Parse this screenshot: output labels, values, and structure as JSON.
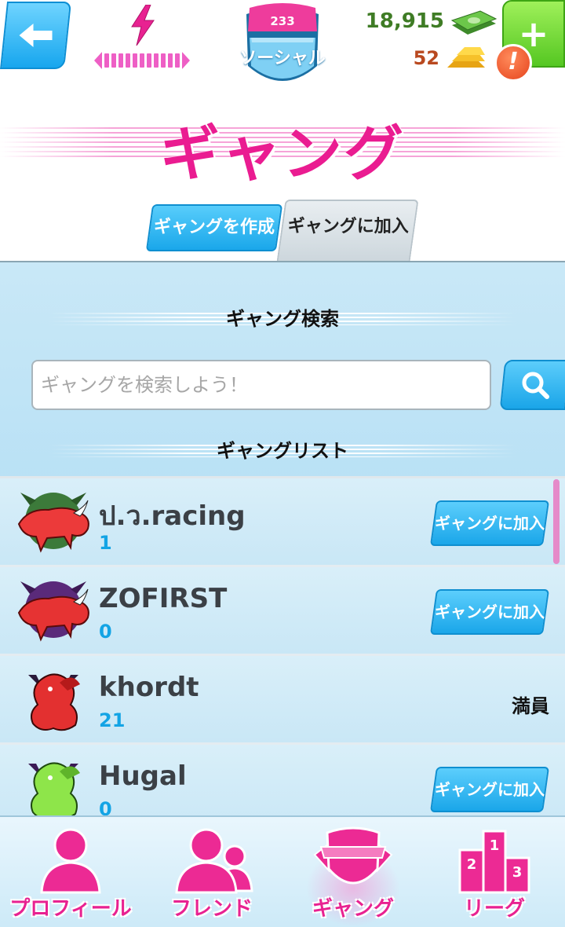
{
  "header": {
    "level": "233",
    "level_label": "ソーシャル",
    "money": "18,915",
    "gold": "52",
    "alert": "!"
  },
  "title": "ギャング",
  "tabs": {
    "create": "ギャングを作成",
    "join": "ギャングに加入"
  },
  "search": {
    "heading": "ギャング検索",
    "placeholder": "ギャングを検索しよう！"
  },
  "list": {
    "heading": "ギャングリスト",
    "rows": [
      {
        "name": "ป.ว.racing",
        "count": "1",
        "action": "ギャングに加入",
        "emblem": "red-bull-green-emblem-icon"
      },
      {
        "name": "ZOFIRST",
        "count": "0",
        "action": "ギャングに加入",
        "emblem": "red-bull-purple-emblem-icon"
      },
      {
        "name": "khordt",
        "count": "21",
        "status": "満員",
        "emblem": "red-griffin-emblem-icon"
      },
      {
        "name": "Hugal",
        "count": "0",
        "action": "ギャングに加入",
        "emblem": "green-griffin-emblem-icon"
      }
    ]
  },
  "nav": {
    "profile": "プロフィール",
    "friends": "フレンド",
    "gang": "ギャング",
    "league": "リーグ"
  },
  "colors": {
    "accent_pink": "#ea1c91",
    "button_blue": "#1aa6e9",
    "add_green": "#55c722"
  }
}
